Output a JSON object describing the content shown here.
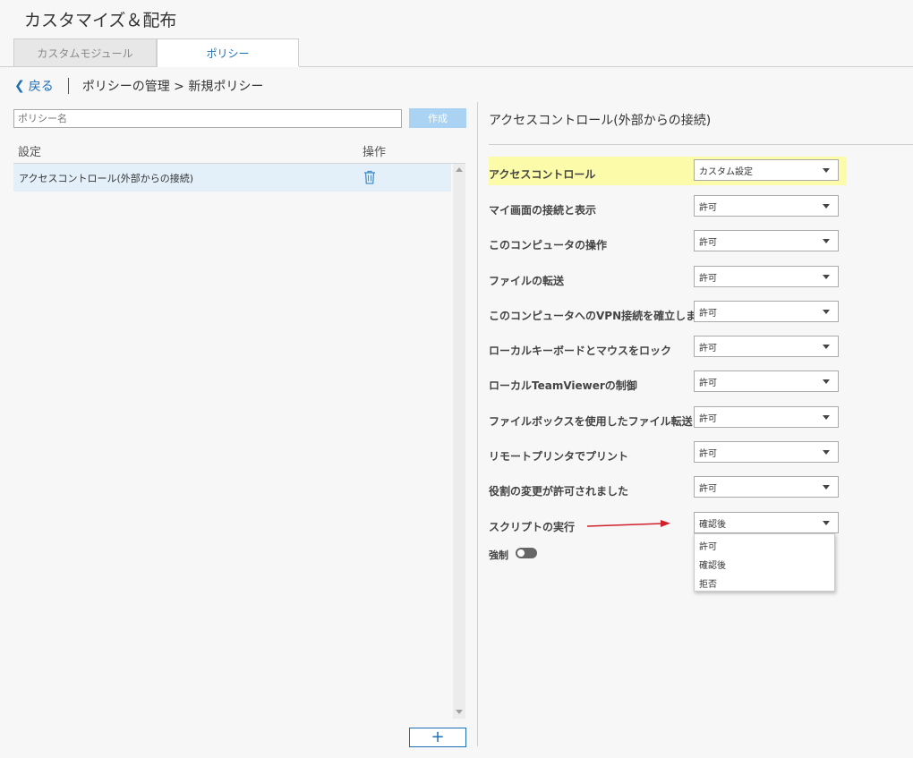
{
  "header": {
    "title": "カスタマイズ＆配布"
  },
  "tabs": [
    {
      "label": "カスタムモジュール"
    },
    {
      "label": "ポリシー"
    }
  ],
  "breadcrumb": {
    "back_label": "戻る",
    "path": "ポリシーの管理 > 新規ポリシー"
  },
  "left": {
    "name_placeholder": "ポリシー名",
    "create_label": "作成",
    "col_setting": "設定",
    "col_action": "操作",
    "rows": [
      {
        "label": "アクセスコントロール(外部からの接続)"
      }
    ],
    "add_label": "+"
  },
  "right": {
    "title": "アクセスコントロール(外部からの接続)",
    "settings": [
      {
        "label": "アクセスコントロール",
        "value": "カスタム設定"
      },
      {
        "label": "マイ画面の接続と表示",
        "value": "許可"
      },
      {
        "label": "このコンピュータの操作",
        "value": "許可"
      },
      {
        "label": "ファイルの転送",
        "value": "許可"
      },
      {
        "label": "このコンピュータへのVPN接続を確立します",
        "value": "許可"
      },
      {
        "label": "ローカルキーボードとマウスをロック",
        "value": "許可"
      },
      {
        "label": "ローカルTeamViewerの制御",
        "value": "許可"
      },
      {
        "label": "ファイルボックスを使用したファイル転送",
        "value": "許可"
      },
      {
        "label": "リモートプリンタでプリント",
        "value": "許可"
      },
      {
        "label": "役割の変更が許可されました",
        "value": "許可"
      },
      {
        "label": "スクリプトの実行",
        "value": "確認後"
      }
    ],
    "dropdown_options": [
      "許可",
      "確認後",
      "拒否"
    ],
    "force_label": "強制"
  },
  "colors": {
    "accent": "#1e6fb6",
    "highlight": "#fbfbaa",
    "arrow": "#d0202a"
  }
}
